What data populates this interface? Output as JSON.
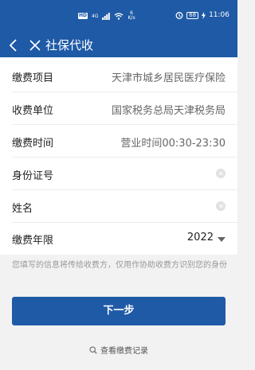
{
  "status_bar": {
    "hd": "HD",
    "signal": "4G",
    "net_speed_value": "6",
    "net_speed_unit": "K/s",
    "battery": "68",
    "time": "11:06"
  },
  "nav": {
    "title": "社保代收"
  },
  "form": {
    "item_label": "缴费项目",
    "item_value": "天津市城乡居民医疗保险",
    "unit_label": "收费单位",
    "unit_value": "国家税务总局天津税务局",
    "time_label": "缴费时间",
    "time_value": "营业时间00:30-23:30",
    "id_label": "身份证号",
    "id_value": "",
    "name_label": "姓名",
    "name_value": "",
    "year_label": "缴费年限",
    "year_value": "2022"
  },
  "notice": "您填写的信息将传给收费方，仅用作协助收费方识别您的身份",
  "next_button": "下一步",
  "record_link": "查看缴费记录",
  "colors": {
    "brand": "#1f5aa6",
    "background": "#f2f2f2"
  },
  "icons": {
    "back": "chevron-left-icon",
    "close": "close-icon",
    "clear": "clear-icon",
    "dropdown": "caret-down-icon",
    "search": "search-icon"
  }
}
